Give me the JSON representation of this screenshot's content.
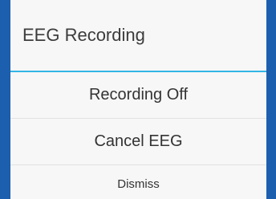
{
  "dialog": {
    "title": "EEG Recording",
    "options": [
      {
        "label": "Recording Off"
      },
      {
        "label": "Cancel EEG"
      },
      {
        "label": "Dismiss"
      }
    ]
  },
  "colors": {
    "backdrop": "#1c5fae",
    "accent_divider": "#33b5e5",
    "dialog_bg": "#f7f7f7"
  }
}
